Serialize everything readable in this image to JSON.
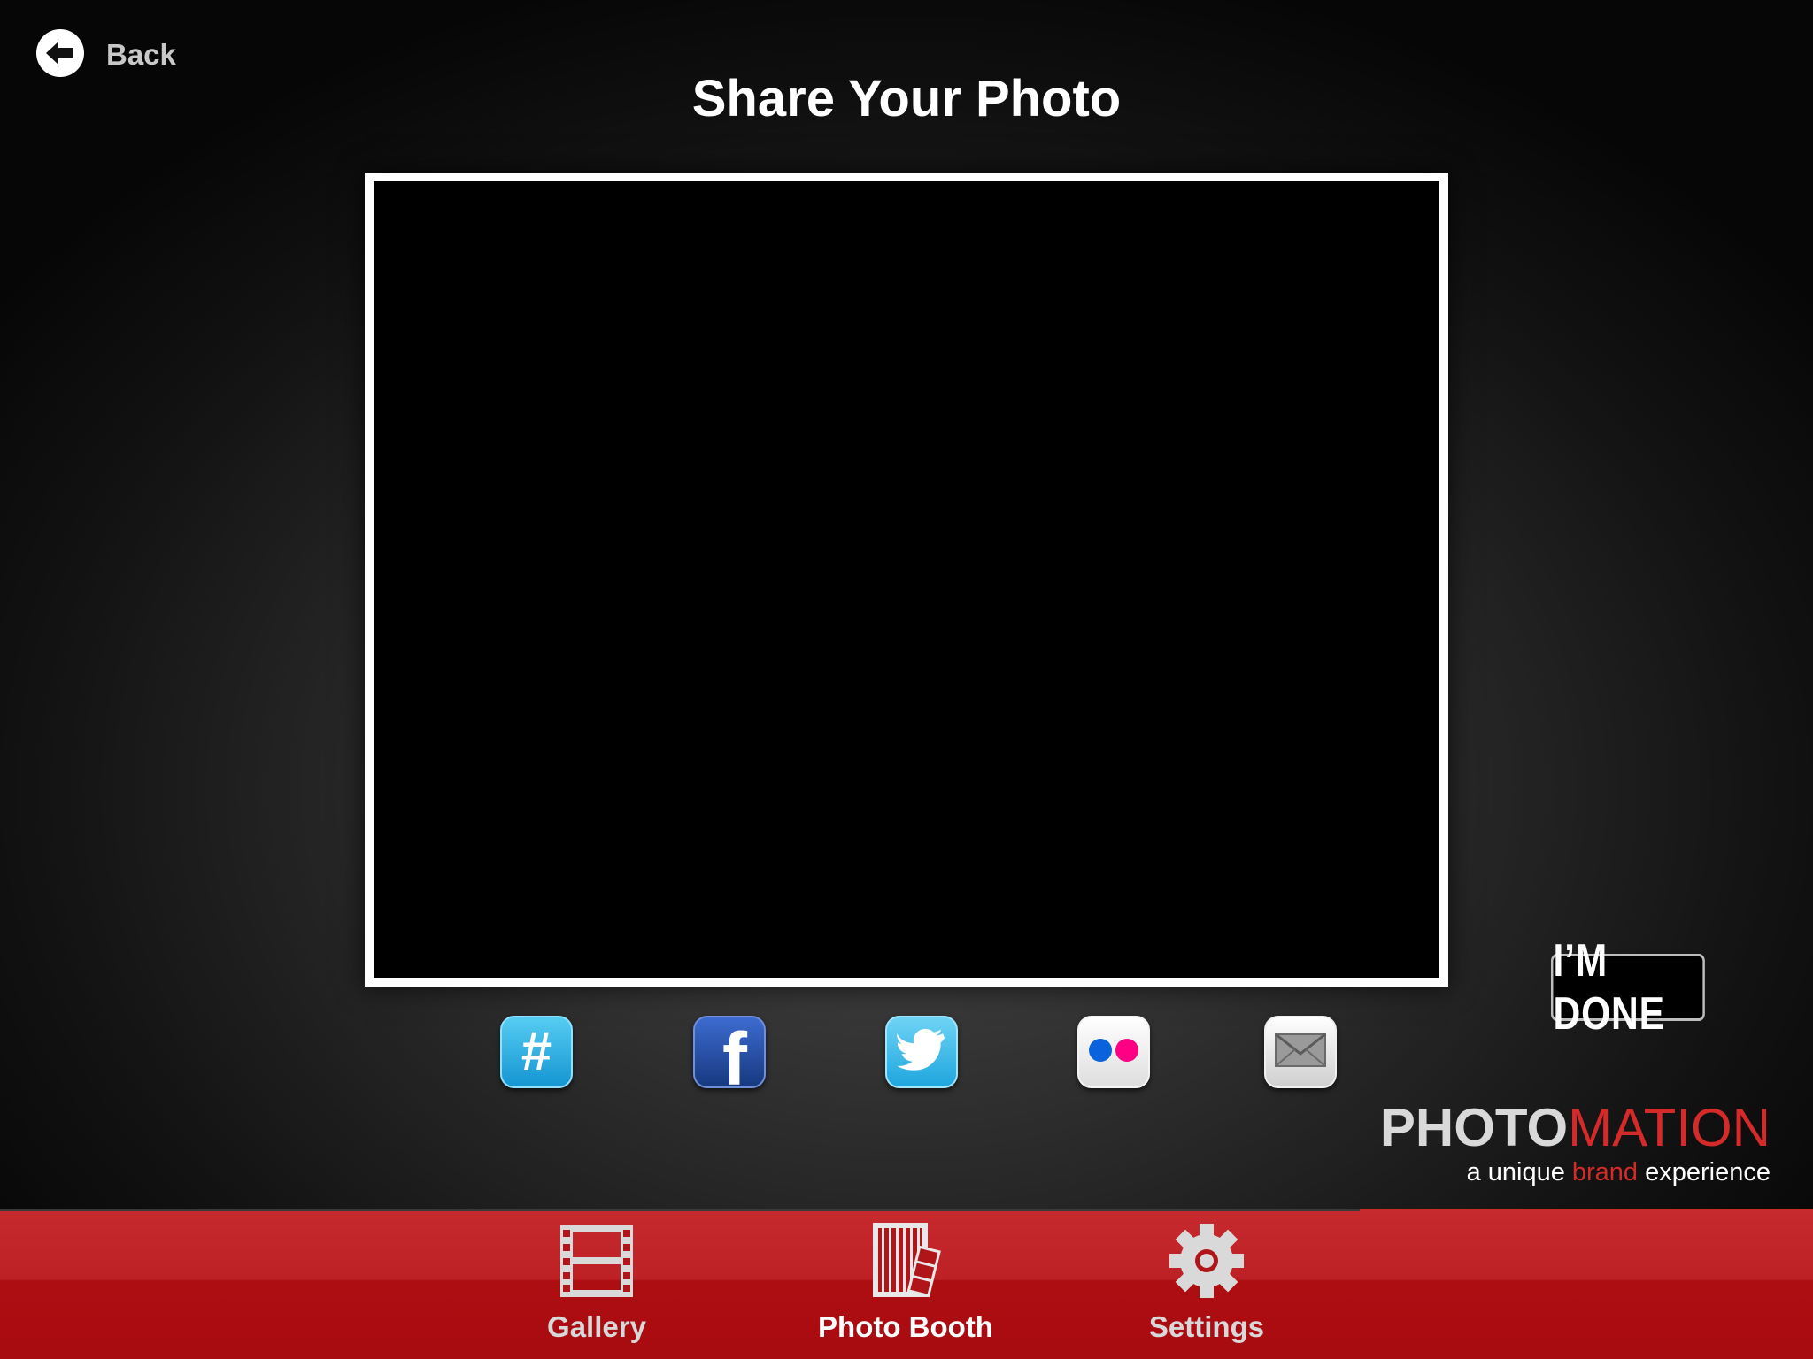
{
  "header": {
    "back_label": "Back",
    "title": "Share Your Photo"
  },
  "share": {
    "icons": [
      {
        "name": "hashtag-icon",
        "glyph": "#"
      },
      {
        "name": "facebook-icon",
        "glyph": "f"
      },
      {
        "name": "twitter-icon"
      },
      {
        "name": "flickr-icon"
      },
      {
        "name": "mail-icon"
      }
    ]
  },
  "done_button": {
    "label": "I’M DONE"
  },
  "brand": {
    "name_part1": "PHOTO",
    "name_part2": "MATION",
    "tagline_pre": "a unique ",
    "tagline_highlight": "brand",
    "tagline_post": " experience",
    "accent_color": "#d42a2a"
  },
  "tabbar": {
    "tabs": [
      {
        "label": "Gallery",
        "icon": "film-strip-icon",
        "active": false
      },
      {
        "label": "Photo Booth",
        "icon": "photo-booth-icon",
        "active": true
      },
      {
        "label": "Settings",
        "icon": "gear-icon",
        "active": false
      }
    ],
    "color": "#b01519"
  }
}
